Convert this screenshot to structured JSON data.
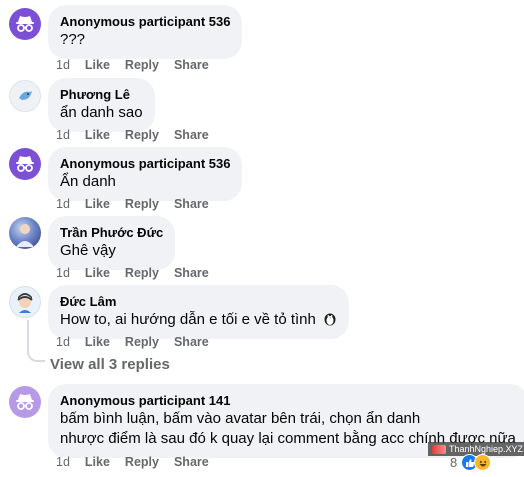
{
  "comments": [
    {
      "name": "Anonymous participant 536",
      "text": "???",
      "time": "1d",
      "like": "Like",
      "reply": "Reply",
      "share": "Share",
      "avatar_icon": "anonymous-incognito-icon"
    },
    {
      "name": "Phương Lê",
      "text": "ẩn danh sao",
      "time": "1d",
      "like": "Like",
      "reply": "Reply",
      "share": "Share",
      "avatar_icon": "user-avatar"
    },
    {
      "name": "Anonymous participant 536",
      "text": "Ẩn danh",
      "time": "1d",
      "like": "Like",
      "reply": "Reply",
      "share": "Share",
      "avatar_icon": "anonymous-incognito-icon"
    },
    {
      "name": "Trần Phước Đức",
      "text": "Ghê vậy",
      "time": "1d",
      "like": "Like",
      "reply": "Reply",
      "share": "Share",
      "avatar_icon": "user-avatar"
    },
    {
      "name": "Đức Lâm",
      "text": "How to, ai hướng dẫn e tối e về tỏ tình",
      "time": "1d",
      "like": "Like",
      "reply": "Reply",
      "share": "Share",
      "avatar_icon": "user-avatar"
    },
    {
      "name": "Anonymous participant 141",
      "text_line1": "bấm bình luận, bấm vào avatar bên trái, chọn ẩn danh",
      "text_line2": "nhược điểm là sau đó k quay lại comment bằng acc chính được nữa",
      "time": "1d",
      "like": "Like",
      "reply": "Reply",
      "share": "Share",
      "avatar_icon": "anonymous-incognito-icon"
    }
  ],
  "view_replies": "View all 3 replies",
  "reaction_count": "8",
  "watermark": "ThanhNghiep.XYZ",
  "colors": {
    "anon_avatar": "#7b4fd6",
    "bubble": "#f0f2f5",
    "meta_text": "#65676b",
    "like_blue": "#1877f2"
  }
}
